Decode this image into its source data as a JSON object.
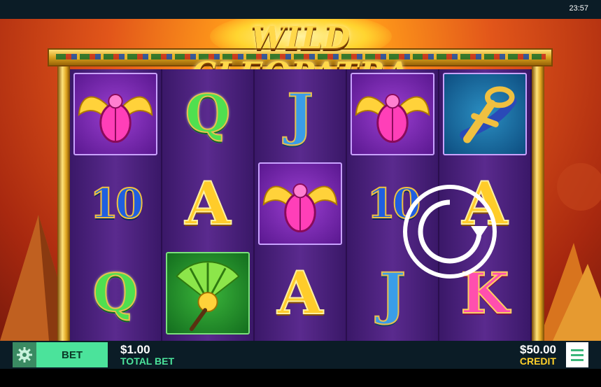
{
  "status": {
    "clock": "23:57"
  },
  "game": {
    "title": "WILD CLEOPATRA",
    "reels": [
      [
        "scarab-wild",
        "10",
        "Q"
      ],
      [
        "Q",
        "A",
        "fan"
      ],
      [
        "J",
        "scarab-wild",
        "A"
      ],
      [
        "scarab-wild",
        "10",
        "J"
      ],
      [
        "ankh",
        "A",
        "K"
      ]
    ]
  },
  "controls": {
    "bet_button": "BET",
    "bet_amount": "$1.00",
    "bet_label": "TOTAL BET",
    "credit_amount": "$50.00",
    "credit_label": "CREDIT"
  },
  "colors": {
    "accent_green": "#4be39b",
    "credit_yellow": "#ffd02a",
    "bar_bg": "#0b1c26"
  }
}
